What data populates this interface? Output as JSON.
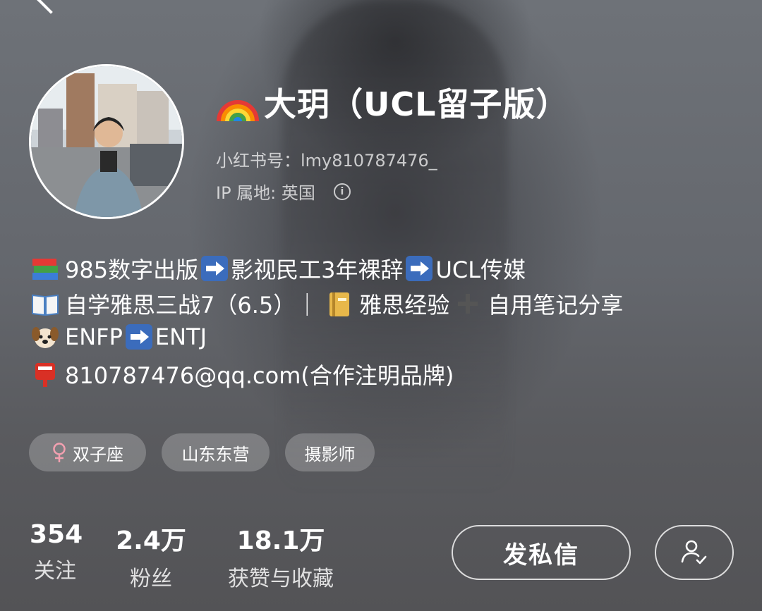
{
  "profile": {
    "nickname": "大玥（UCL留子版）",
    "red_id": "小红书号：lmy810787476_",
    "ip_location": "IP 属地: 英国",
    "rainbow_icon": "rainbow-emoji"
  },
  "bio": {
    "line1": {
      "part1": "985数字出版",
      "part2": "影视民工3年裸辞",
      "part3": "UCL传媒"
    },
    "line2": {
      "part1": "自学雅思三战7（6.5）｜",
      "part2": "雅思经验",
      "part3": "自用笔记分享"
    },
    "line3": {
      "part1": "ENFP",
      "part2": "ENTJ"
    },
    "line4": {
      "part1": "810787476@qq.com(合作注明品牌)"
    }
  },
  "tags": [
    {
      "label": "双子座",
      "icon": "female-icon",
      "color": "#f2a0b0"
    },
    {
      "label": "山东东营"
    },
    {
      "label": "摄影师"
    }
  ],
  "stats": [
    {
      "num": "354",
      "label": "关注"
    },
    {
      "num": "2.4万",
      "label": "粉丝"
    },
    {
      "num": "18.1万",
      "label": "获赞与收藏"
    }
  ],
  "actions": {
    "message_label": "发私信",
    "follow_icon": "user-check-icon"
  }
}
